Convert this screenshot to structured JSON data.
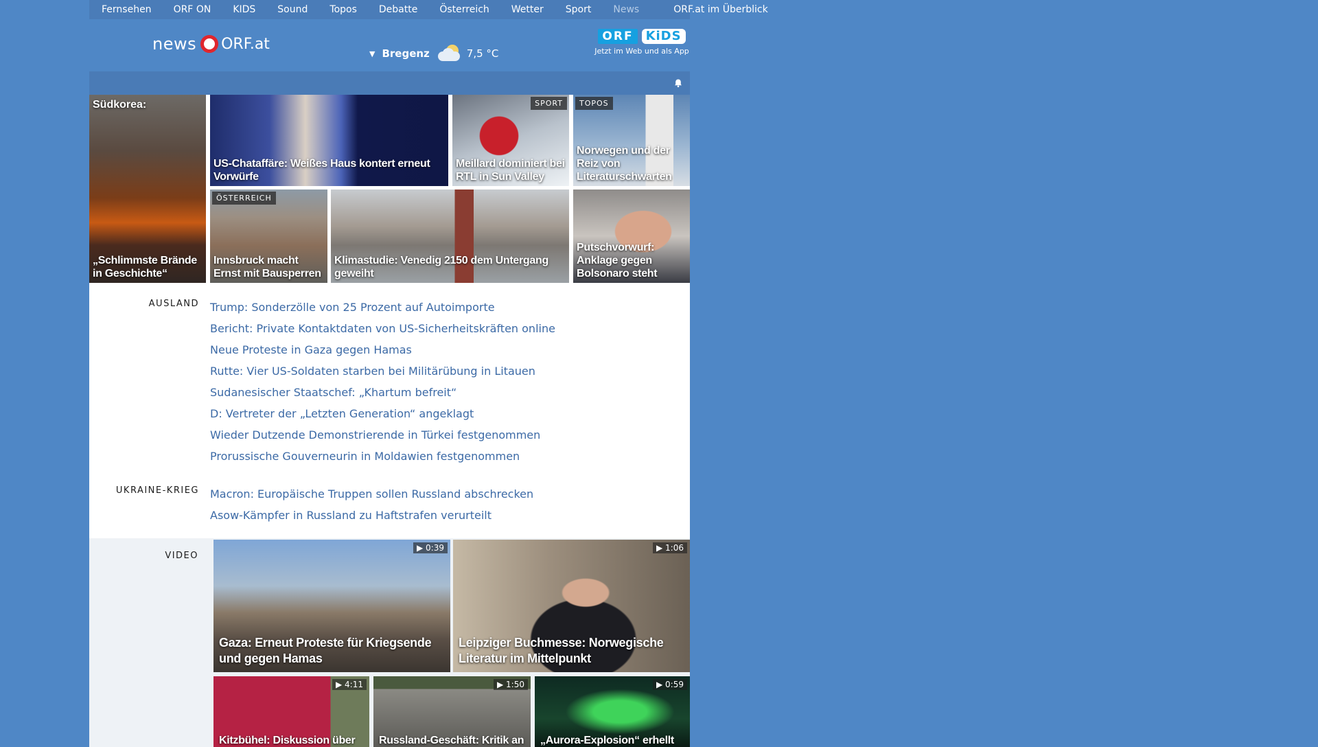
{
  "topnav": {
    "items": [
      "Fernsehen",
      "ORF ON",
      "KIDS",
      "Sound",
      "Topos",
      "Debatte",
      "Österreich",
      "Wetter",
      "Sport",
      "News"
    ],
    "overview": "ORF.at im Überblick"
  },
  "header": {
    "logo_news": "news",
    "logo_orf": "ORF.at",
    "weather": {
      "city": "Bregenz",
      "temperature": "7,5 °C",
      "icon": "partly-cloudy-icon"
    },
    "kids_promo": {
      "orf": "ORF",
      "kids": "KiDS",
      "subtitle": "Jetzt im Web und als App"
    }
  },
  "stories": {
    "s1": {
      "top": "Südkorea:",
      "caption": "„Schlimmste Brände in Geschichte“"
    },
    "s2": {
      "caption": "US-Chataffäre: Weißes Haus kontert erneut Vorwürfe"
    },
    "s3": {
      "tag": "SPORT",
      "caption": "Meillard dominiert bei RTL in Sun Valley"
    },
    "s4": {
      "tag": "TOPOS",
      "caption": "Norwegen und der Reiz von Literaturschwarten"
    },
    "s5": {
      "tag": "ÖSTERREICH",
      "caption": "Innsbruck macht Ernst mit Bausperren"
    },
    "s6": {
      "caption": "Klimastudie: Venedig 2150 dem Untergang geweiht"
    },
    "s7": {
      "caption": "Putschvorwurf: Anklage gegen Bolsonaro steht"
    }
  },
  "ausland": {
    "label": "AUSLAND",
    "items": [
      "Trump: Sonderzölle von 25 Prozent auf Autoimporte",
      "Bericht: Private Kontaktdaten von US-Sicherheitskräften online",
      "Neue Proteste in Gaza gegen Hamas",
      "Rutte: Vier US-Soldaten starben bei Militärübung in Litauen",
      "Sudanesischer Staatschef: „Khartum befreit“",
      "D: Vertreter der „Letzten Generation“ angeklagt",
      "Wieder Dutzende Demonstrierende in Türkei festgenommen",
      "Prorussische Gouverneurin in Moldawien festgenommen"
    ]
  },
  "ukraine": {
    "label": "UKRAINE-KRIEG",
    "items": [
      "Macron: Europäische Truppen sollen Russland abschrecken",
      "Asow-Kämpfer in Russland zu Haftstrafen verurteilt"
    ]
  },
  "video": {
    "label": "VIDEO",
    "v1": {
      "duration": "0:39",
      "caption": "Gaza: Erneut Proteste für Kriegsende und gegen Hamas"
    },
    "v2": {
      "duration": "1:06",
      "caption": "Leipziger Buchmesse: Norwegische Literatur im Mittelpunkt"
    },
    "v3": {
      "duration": "4:11",
      "caption": "Kitzbühel: Diskussion über"
    },
    "v4": {
      "duration": "1:50",
      "caption": "Russland-Geschäft: Kritik an"
    },
    "v5": {
      "duration": "0:59",
      "caption": "„Aurora-Explosion“ erhellt"
    }
  }
}
